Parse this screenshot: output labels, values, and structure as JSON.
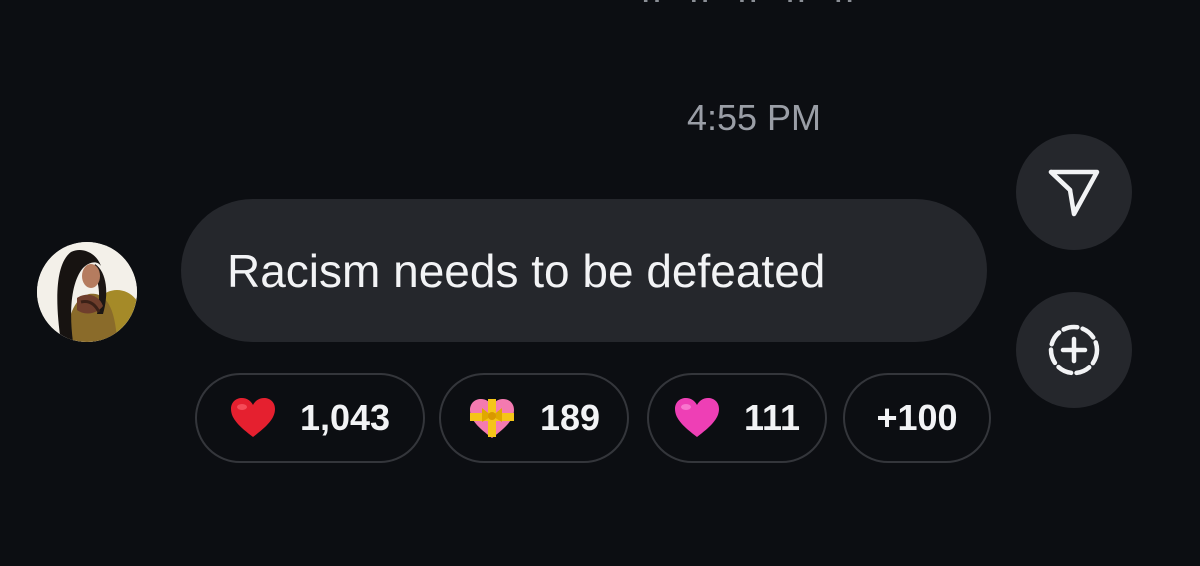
{
  "message": {
    "timestamp": "4:55 PM",
    "text": "Racism needs to be defeated"
  },
  "reactions": [
    {
      "icon": "red-heart-icon",
      "count": "1,043"
    },
    {
      "icon": "heart-with-ribbon-icon",
      "count": "189"
    },
    {
      "icon": "pink-heart-icon",
      "count": "111"
    },
    {
      "icon": null,
      "count": "+100"
    }
  ],
  "actions": {
    "share_icon": "send-icon",
    "add_reaction_icon": "add-circle-icon"
  },
  "colors": {
    "background": "#0c0e12",
    "bubble": "#25272c",
    "text": "#f2f3f5",
    "muted": "#9a9ea6",
    "red_heart": "#e5202f",
    "pink_heart": "#ee3fb5"
  }
}
